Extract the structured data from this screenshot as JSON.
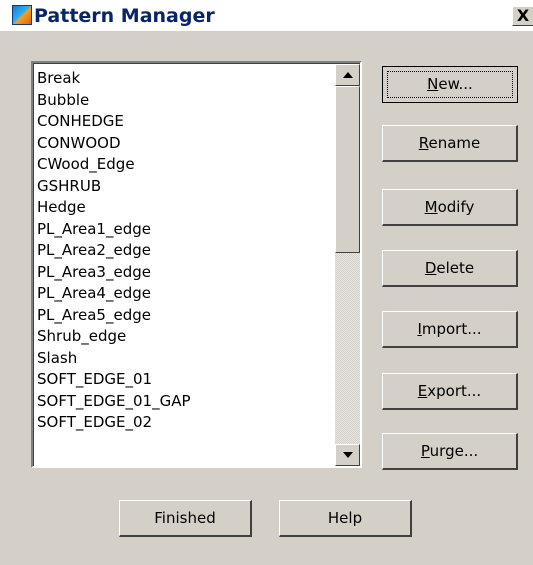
{
  "window": {
    "title": "Pattern Manager",
    "close_label": "X"
  },
  "pattern_list": {
    "items": [
      "Break",
      "Bubble",
      "CONHEDGE",
      "CONWOOD",
      "CWood_Edge",
      "GSHRUB",
      "Hedge",
      "PL_Area1_edge",
      "PL_Area2_edge",
      "PL_Area3_edge",
      "PL_Area4_edge",
      "PL_Area5_edge",
      "Shrub_edge",
      "Slash",
      "SOFT_EDGE_01",
      "SOFT_EDGE_01_GAP",
      "SOFT_EDGE_02"
    ]
  },
  "buttons": {
    "new": {
      "mnemonic": "N",
      "rest": "ew..."
    },
    "rename": {
      "mnemonic": "R",
      "rest": "ename"
    },
    "modify": {
      "mnemonic": "M",
      "rest": "odify"
    },
    "delete": {
      "mnemonic": "D",
      "rest": "elete"
    },
    "import": {
      "mnemonic": "I",
      "rest": "mport..."
    },
    "export": {
      "mnemonic": "E",
      "rest": "xport..."
    },
    "purge": {
      "mnemonic": "P",
      "rest": "urge..."
    },
    "finished": "Finished",
    "help": "Help"
  },
  "colors": {
    "dialog_bg": "#d4d0c8",
    "title_text": "#0a246a"
  },
  "icons": {
    "app": "pattern-manager-app-icon",
    "close": "close-icon",
    "scroll_up": "scroll-up-arrow-icon",
    "scroll_down": "scroll-down-arrow-icon"
  }
}
